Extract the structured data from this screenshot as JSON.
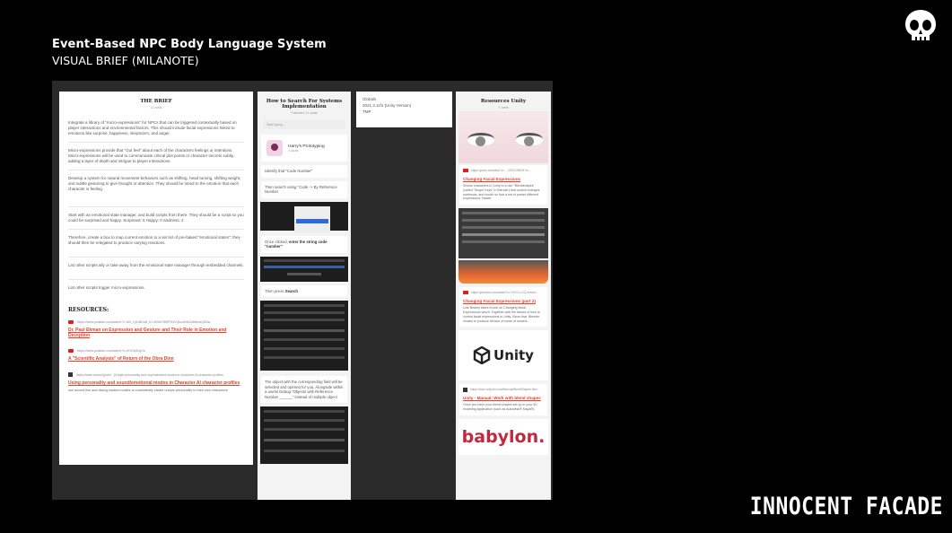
{
  "slide": {
    "title": "Event-Based NPC Body Language System",
    "subtitle": "VISUAL BRIEF (MILANOTE)",
    "brand": "INNOCENT FACADE",
    "logo_icon": "skull-icon"
  },
  "brief": {
    "heading": "THE BRIEF",
    "count": "11 cards",
    "paragraphs": [
      "Integrate a library of \"micro-expressions\" for NPCs that can be triggered contextually based on player interactions and environmental factors. This should include facial expressions linked to emotions like surprise, happiness, skepticism, and anger.",
      "Micro-expressions provide that \"Gut feel\" about each of the characters feelings or intentions. Micro-expressions will be used to communicate critical plot points or character secrets subtly, adding a layer of depth and intrigue to player interactions.",
      "Develop a system for natural movement behaviors such as shifting, head turning, shifting weight, and subtle gesturing to give thought or attention. They should be timed to the emotion that each character is feeling.",
      "Start with an emotional state manager, and build scripts from there. They should be a script so you could be surprised and happy.\nSurprised: 5\nHappy: 0\nSadness: 4",
      "Therefore, create a box to map current emotion to a set list of pre-baked \"emotional states\"; they should then be relegated to produce varying reactions.",
      "List other scripts ally or take away from the emotional state manager through embedded channels.",
      "List other scripts trigger micro-expressions."
    ],
    "resources_heading": "RESOURCES:",
    "links": [
      {
        "url": "https://www.youtube.com/watch?v=Ut0_LjKvBDw8_ID=MX6C9B9FS3VQIuz6hMOdMbedQDDw",
        "title": "Dr. Paul Ekman on Expression and Gesture and Their Role in Emotion and Deception",
        "icon": "youtube-icon"
      },
      {
        "url": "https://www.youtube.com/watch?v=d7vSU6hqGs",
        "title": "A \"Scientific Analysis\" of Return of the Obra Dinn",
        "icon": "youtube-icon"
      },
      {
        "url": "https://www.uxcom/[publi…]/l-style-personality-and-sophisticated-modes-in-character-AI-character-profiles",
        "title": "Using personality and sound/emotional modes in Character AI character profiles",
        "desc": "use accent like and dialog-loaded models to consistently create unique personality to their own characters",
        "icon": "article-icon"
      }
    ]
  },
  "search": {
    "heading": "How to Search For Systems Implementation",
    "count": "Followers 11 cards",
    "search_placeholder": "Start typing…",
    "proto_name": "Harry's Prototyping",
    "proto_count": "3 cards",
    "card1": "Identify that \"Code Number\"",
    "card2": "Then search using \"Code -> By Reference Number",
    "card3_pre": "Once clicked, ",
    "card3_bold": "enter the string code \"number\"",
    "card4_pre": "Then press ",
    "card4_bold": "Search",
    "card5": "The object with the corresponding field will be selected and opened for you. Alongside within a useful Debug \"Objects with Reference Number ______\" instead of multiple object"
  },
  "mini": {
    "line1": "Globals",
    "line2": "2021.3.11f1 (Unity Version)",
    "line3": "TMP"
  },
  "resources": {
    "heading": "Resources Unity",
    "count": "7 cards",
    "items": [
      {
        "url": "https://youtu.be/watch?v=…2202139675?s=...",
        "title": "Changing Facial Expressions",
        "desc": "Shows characters in Unity to a use \"Blendshapes\" (called \"Shape Keys\" in Blender) that control changes, eyebrows, and mouth so that a set of preset different expressions. Newer",
        "icon": "youtube-icon"
      },
      {
        "url": "https://youtube.com/watch?v=Y0CCLLGQ-Arerid=...",
        "title": "Changing Facial Expressions (part 2)",
        "desc": "Lots Beamy takes a look on Changing facial Expressions which. Together with the basics of how to control facial expressions in Unity. Since that, Blender modes to produce all face of some of models.",
        "icon": "youtube-icon"
      },
      {
        "url": "https://docs.unity3d.com/Manual/BlendShapes.html",
        "title": "Unity - Manual: Work with blend shapes",
        "desc": "Once you have your blend shapes set up in your 3D modeling application (such as Autodesk® Maya®).",
        "icon": "unity-icon"
      }
    ],
    "unity_logo": "Unity",
    "babylon_logo": "babylon."
  },
  "colors": {
    "background": "#000000",
    "board": "#2a2a2a",
    "link": "#e0422b",
    "babylon": "#c02a3c"
  }
}
